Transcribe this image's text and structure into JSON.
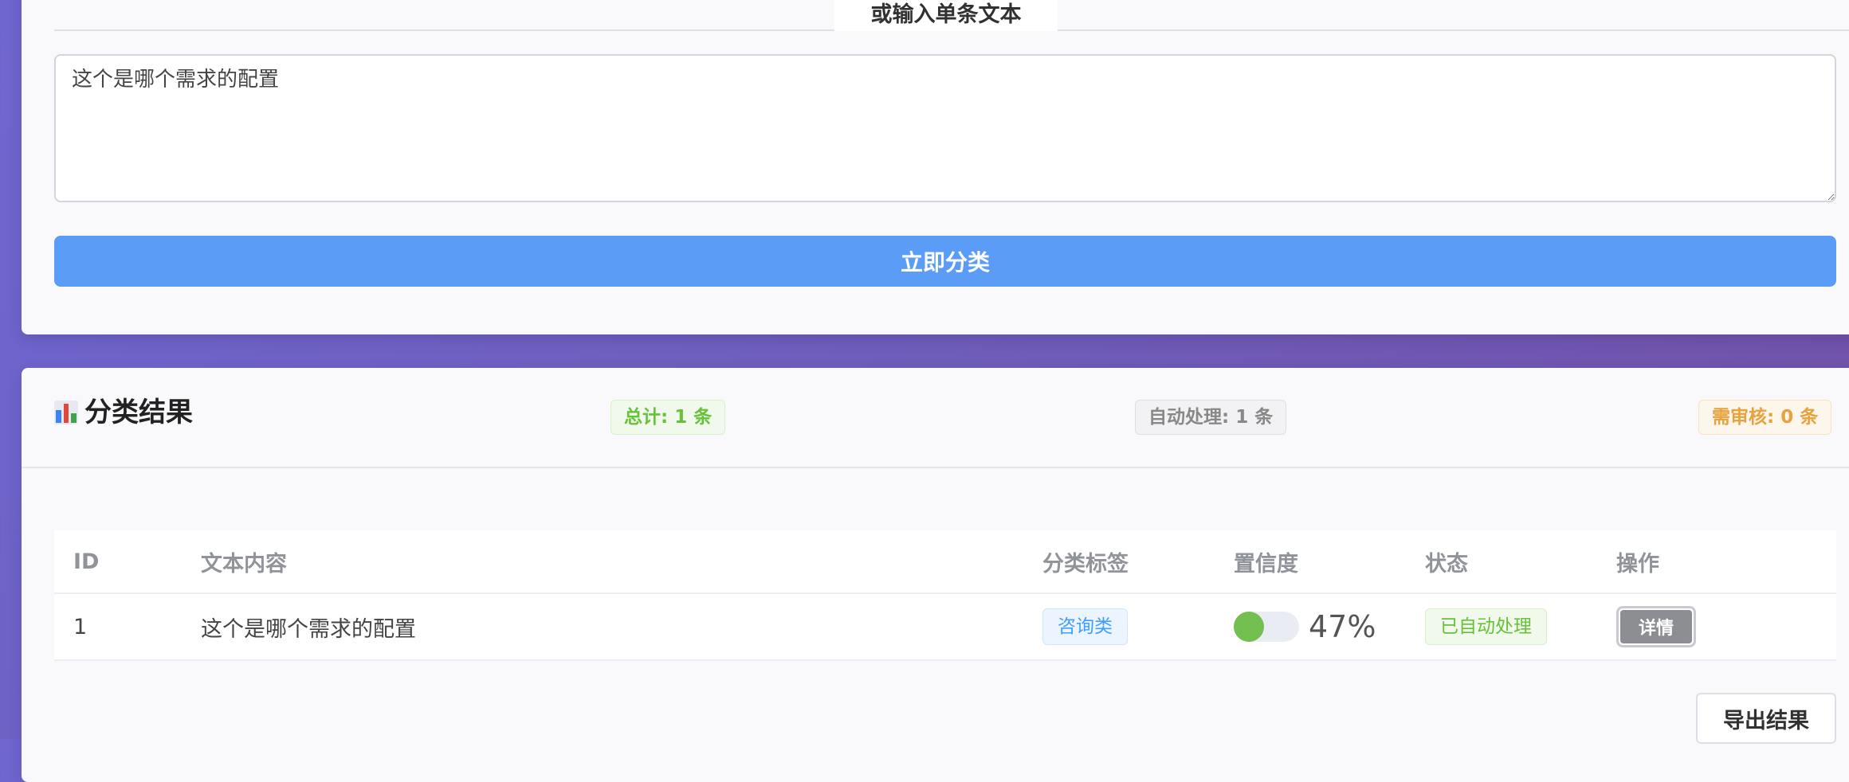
{
  "input": {
    "divider_title": "或输入单条文本",
    "text_value": "这个是哪个需求的配置",
    "submit_label": "立即分类"
  },
  "results": {
    "title": "分类结果",
    "stats": {
      "total": "总计: 1 条",
      "auto": "自动处理: 1 条",
      "review": "需审核: 0 条"
    },
    "columns": [
      "ID",
      "文本内容",
      "分类标签",
      "置信度",
      "状态",
      "操作"
    ],
    "rows": [
      {
        "id": "1",
        "text": "这个是哪个需求的配置",
        "label": "咨询类",
        "confidence": 47,
        "confidence_text": "47%",
        "status": "已自动处理",
        "action": "详情"
      }
    ],
    "export_label": "导出结果"
  },
  "colors": {
    "primary": "#5b9cf6",
    "success": "#67c23a",
    "warning": "#e6a23c",
    "info": "#409eff"
  }
}
